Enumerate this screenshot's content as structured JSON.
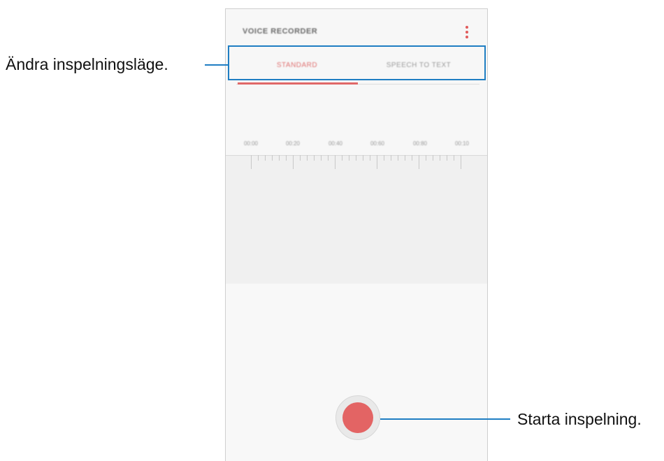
{
  "app": {
    "title": "VOICE RECORDER",
    "accent_color": "#e36464",
    "menu_icon": "more-vertical-icon"
  },
  "tabs": [
    {
      "label": "STANDARD",
      "active": true
    },
    {
      "label": "SPEECH TO TEXT",
      "active": false
    }
  ],
  "timeline": {
    "labels": [
      "00:00",
      "00:20",
      "00:40",
      "00:60",
      "00:80",
      "00:10"
    ]
  },
  "record_button": {
    "icon": "record-icon",
    "color": "#e36464"
  },
  "annotations": {
    "mode_label": "Ändra inspelningsläge.",
    "record_label": "Starta inspelning.",
    "color": "#1f7ec3"
  }
}
